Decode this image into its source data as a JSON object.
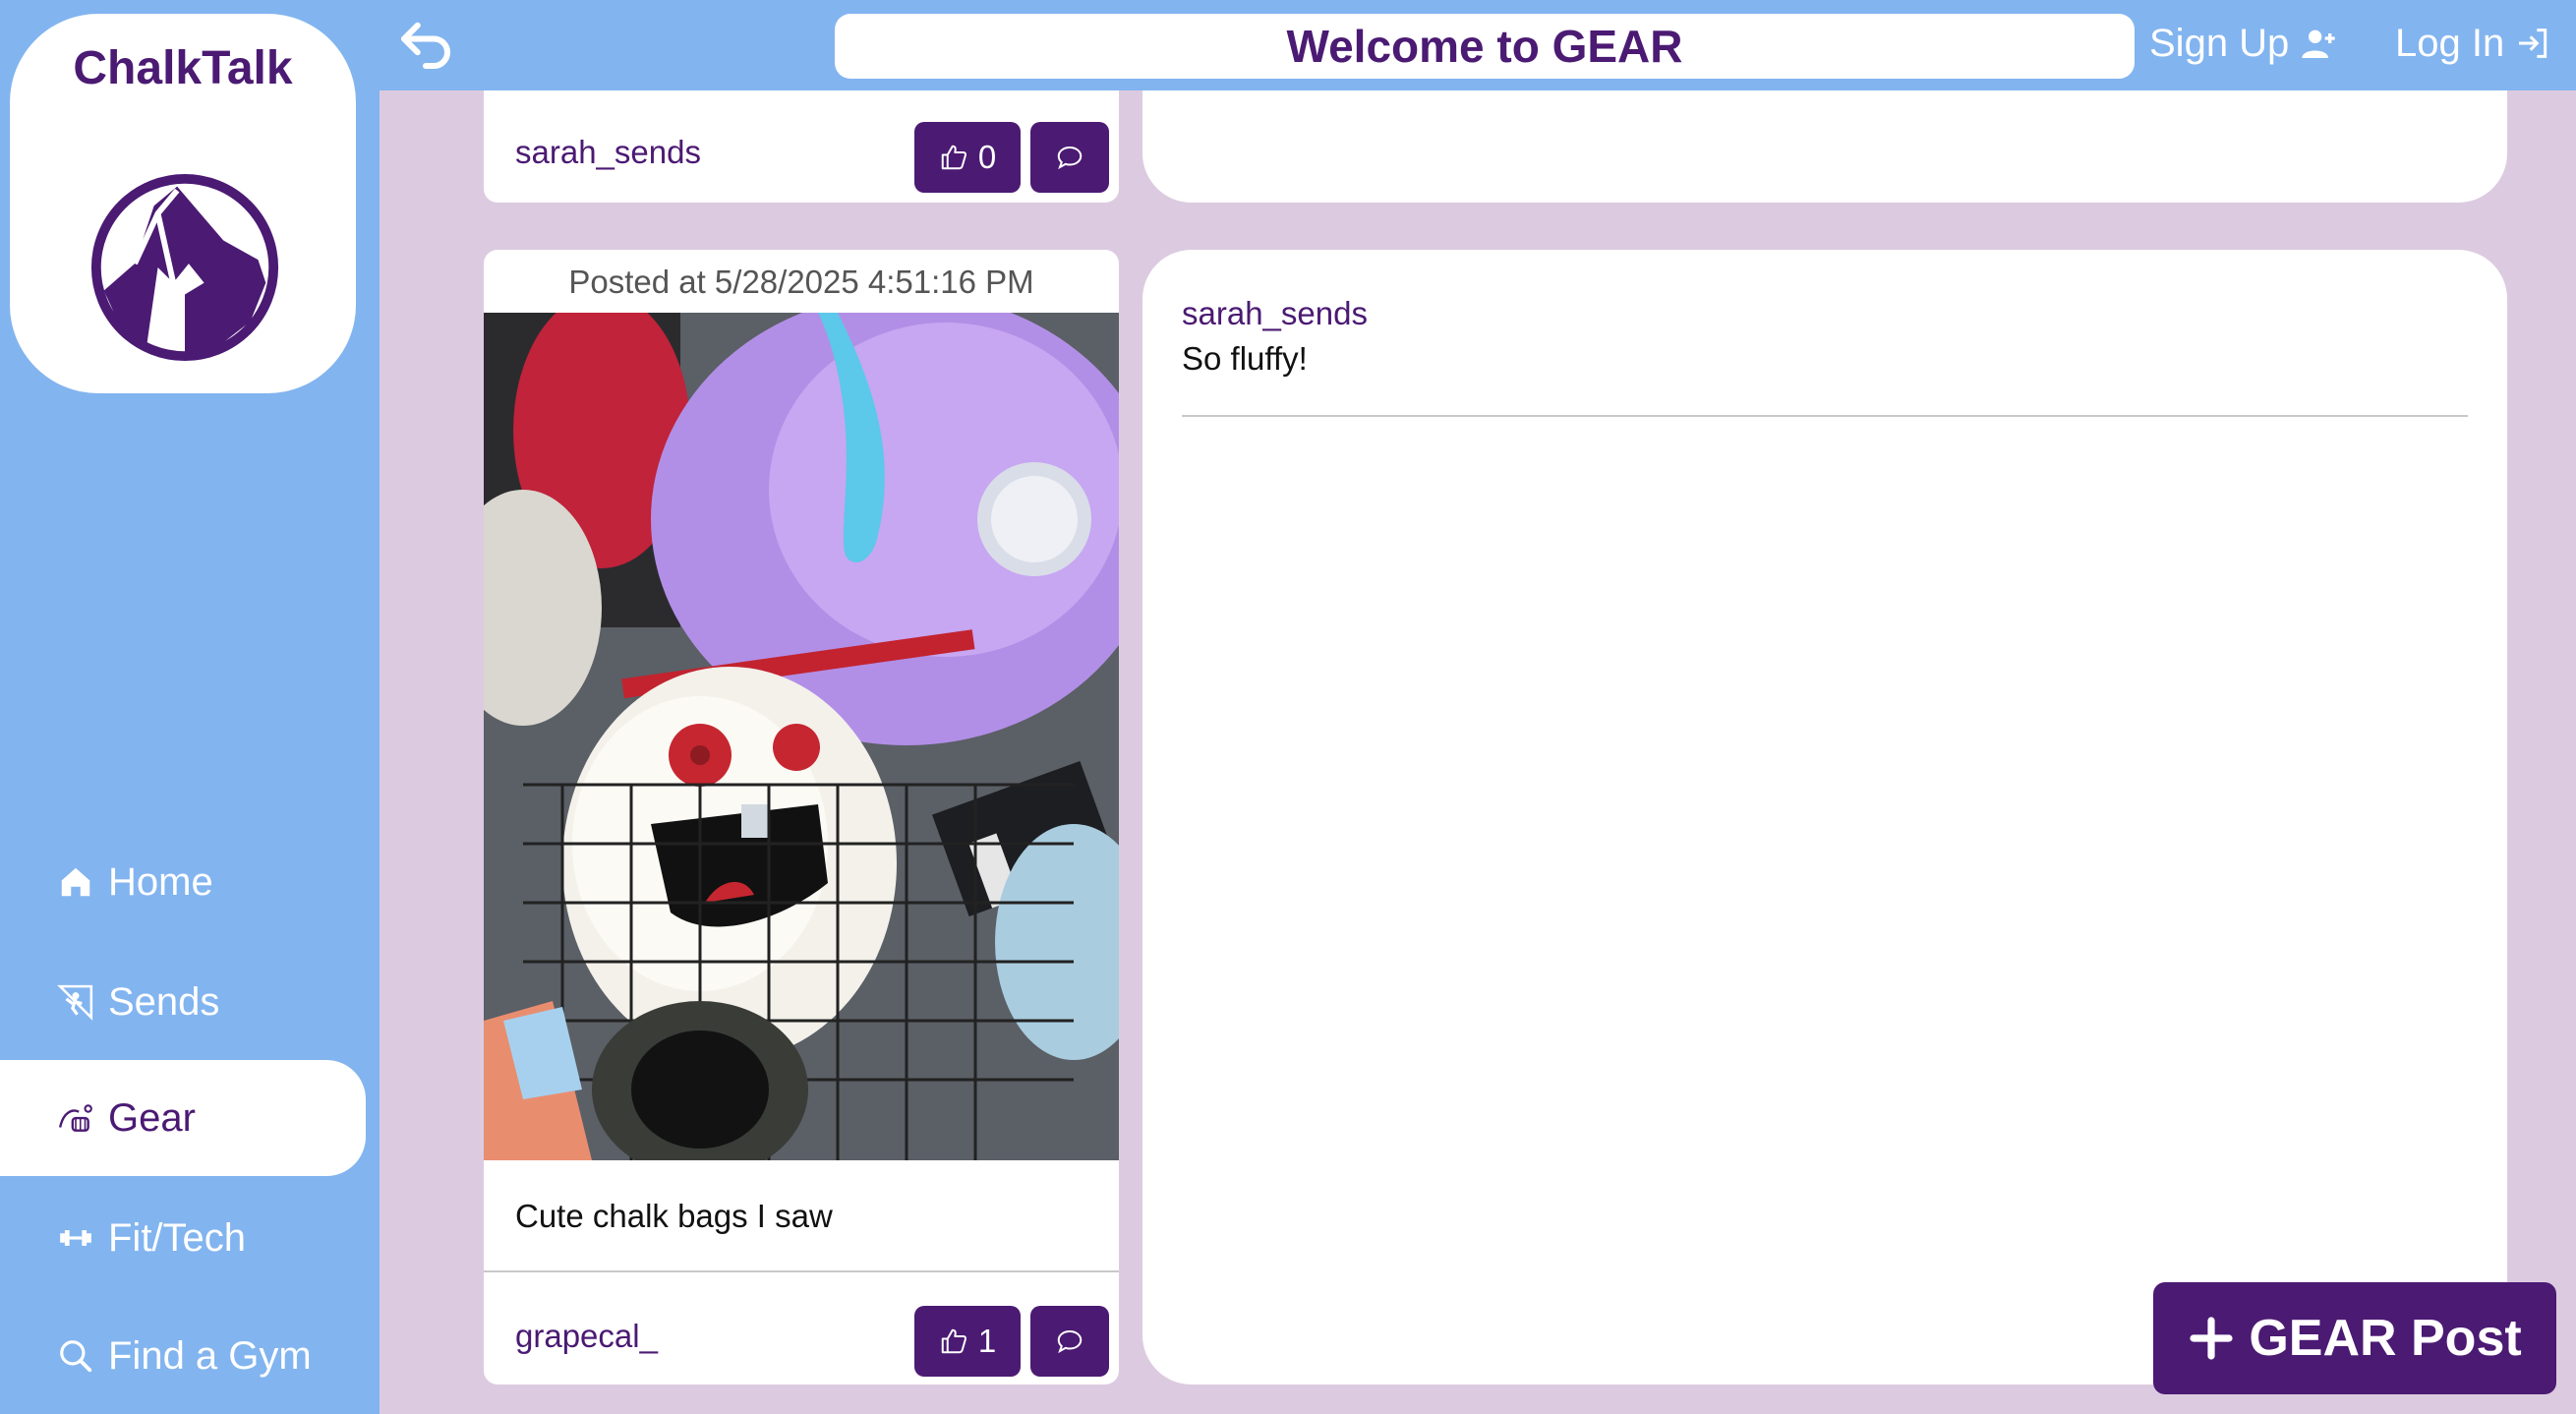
{
  "app": {
    "name": "ChalkTalk"
  },
  "header": {
    "title": "Welcome to GEAR",
    "sign_up_label": "Sign Up",
    "log_in_label": "Log In"
  },
  "sidebar": {
    "items": [
      {
        "label": "Home",
        "icon": "home-icon"
      },
      {
        "label": "Sends",
        "icon": "climber-icon"
      },
      {
        "label": "Gear",
        "icon": "gear-harness-icon",
        "active": true
      },
      {
        "label": "Fit/Tech",
        "icon": "dumbbell-icon"
      },
      {
        "label": "Find a Gym",
        "icon": "search-icon"
      }
    ]
  },
  "posts": [
    {
      "username": "sarah_sends",
      "likes": "0"
    },
    {
      "posted_at": "Posted at 5/28/2025 4:51:16 PM",
      "caption": "Cute chalk bags I saw",
      "username": "grapecal_",
      "likes": "1"
    }
  ],
  "comments": [
    {
      "username": "sarah_sends",
      "text": "So fluffy!"
    }
  ],
  "fab": {
    "label": "GEAR Post"
  },
  "colors": {
    "primary": "#4b1a73",
    "sidebar": "#82b4ef",
    "background": "#dccbe0"
  }
}
